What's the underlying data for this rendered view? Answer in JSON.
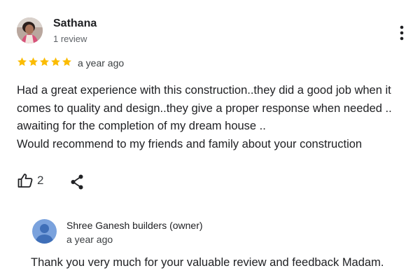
{
  "review": {
    "reviewer_name": "Sathana",
    "review_count": "1 review",
    "rating": 5,
    "rating_max": 5,
    "time": "a year ago",
    "text_lines": [
      "Had a great experience with this construction..they did a good job when it",
      "comes to quality and design..they give a proper response when needed ..",
      "awaiting for the completion of my dream house ..",
      "Would recommend to my friends and family about your construction"
    ],
    "like_count": "2"
  },
  "owner_response": {
    "name": "Shree Ganesh builders (owner)",
    "time": "a year ago",
    "text": "Thank you very much for your valuable review and feedback Madam."
  },
  "icons": {
    "more": "more-vert-icon",
    "star": "star-icon",
    "like": "thumbs-up-icon",
    "share": "share-icon",
    "owner_avatar": "default-user-avatar-icon"
  },
  "colors": {
    "star": "#fbbc04",
    "secondary_text": "#5f6368",
    "owner_avatar_bg": "#7aa2dd"
  }
}
